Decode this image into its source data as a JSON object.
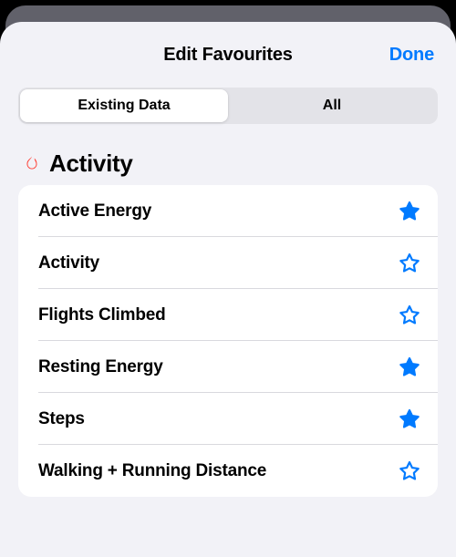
{
  "nav": {
    "title": "Edit Favourites",
    "done": "Done"
  },
  "segments": {
    "existing": "Existing Data",
    "all": "All"
  },
  "activity": {
    "icon": "flame-icon",
    "title": "Activity",
    "items": [
      {
        "label": "Active Energy",
        "favourite": true
      },
      {
        "label": "Activity",
        "favourite": false
      },
      {
        "label": "Flights Climbed",
        "favourite": false
      },
      {
        "label": "Resting Energy",
        "favourite": true
      },
      {
        "label": "Steps",
        "favourite": true
      },
      {
        "label": "Walking + Running Distance",
        "favourite": false
      }
    ]
  },
  "colors": {
    "accent": "#007aff",
    "flame": "#ff3b30"
  }
}
